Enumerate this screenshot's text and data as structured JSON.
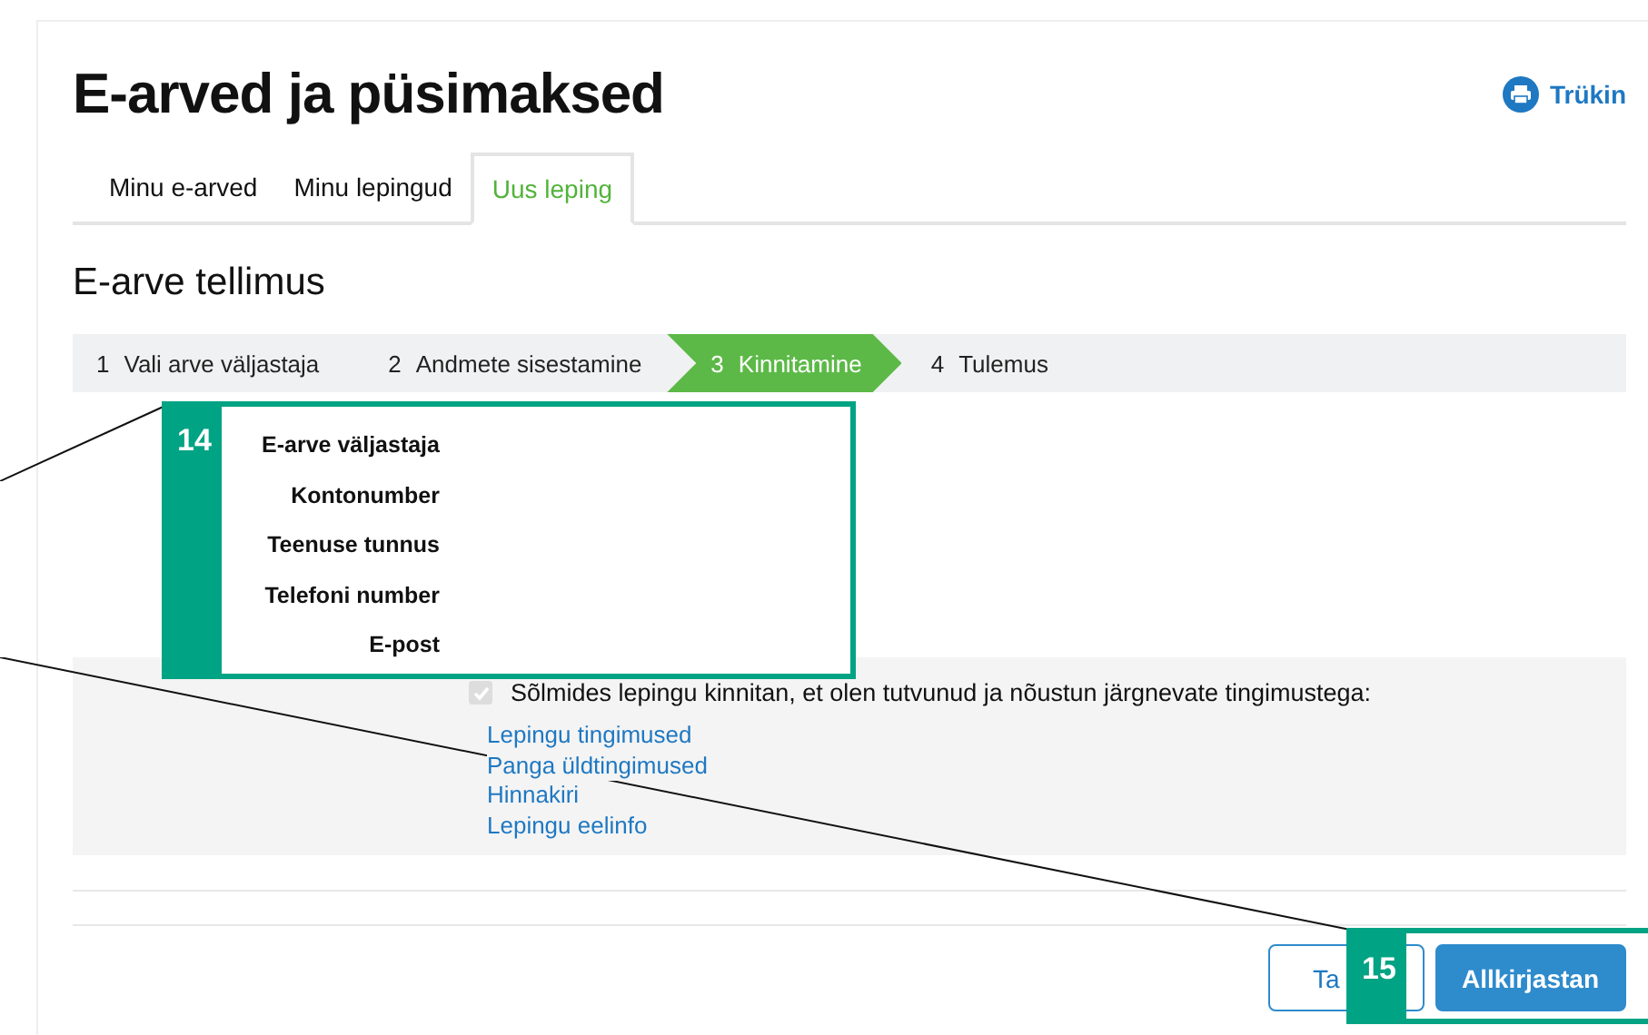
{
  "page_title": "E-arved ja püsimaksed",
  "print_link": {
    "label": "Trükin"
  },
  "tabs": [
    {
      "label": "Minu e-arved",
      "selected": false
    },
    {
      "label": "Minu lepingud",
      "selected": false
    },
    {
      "label": "Uus leping",
      "selected": true
    }
  ],
  "section_title": "E-arve tellimus",
  "steps": [
    {
      "number": "1",
      "label": "Vali arve väljastaja",
      "selected": false
    },
    {
      "number": "2",
      "label": "Andmete sisestamine",
      "selected": false
    },
    {
      "number": "3",
      "label": "Kinnitamine",
      "selected": true
    },
    {
      "number": "4",
      "label": "Tulemus",
      "selected": false
    }
  ],
  "summary_fields": [
    "E-arve väljastaja",
    "Kontonumber",
    "Teenuse tunnus",
    "Telefoni number",
    "E-post"
  ],
  "consent": {
    "checked": true,
    "disabled": true,
    "text": "Sõlmides lepingu kinnitan, et olen tutvunud ja nõustun järgnevate tingimustega:"
  },
  "links": [
    "Lepingu tingimused",
    "Panga üldtingimused",
    "Hinnakiri",
    "Lepingu eelinfo"
  ],
  "buttons": [
    {
      "label": "Ta",
      "kind": "secondary"
    },
    {
      "label": "Allkirjastan",
      "kind": "primary"
    }
  ],
  "callouts": [
    {
      "number": "14"
    },
    {
      "number": "15"
    }
  ]
}
